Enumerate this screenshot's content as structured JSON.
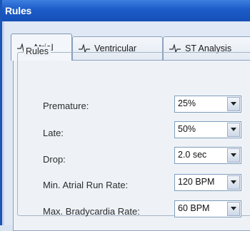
{
  "window": {
    "title": "Rules"
  },
  "tabs": [
    {
      "label": "Atrial",
      "icon": "ecg-waveform-icon",
      "active": true
    },
    {
      "label": "Ventricular",
      "icon": "ecg-waveform-icon",
      "active": false
    },
    {
      "label": "ST Analysis",
      "icon": "ecg-waveform-icon",
      "active": false
    }
  ],
  "group": {
    "label": "Rules"
  },
  "rules": [
    {
      "label": "Premature:",
      "value": "25%"
    },
    {
      "label": "Late:",
      "value": "50%"
    },
    {
      "label": "Drop:",
      "value": "2.0 sec"
    },
    {
      "label": "Min. Atrial Run Rate:",
      "value": "120 BPM"
    },
    {
      "label": "Max. Bradycardia Rate:",
      "value": "60 BPM"
    }
  ]
}
